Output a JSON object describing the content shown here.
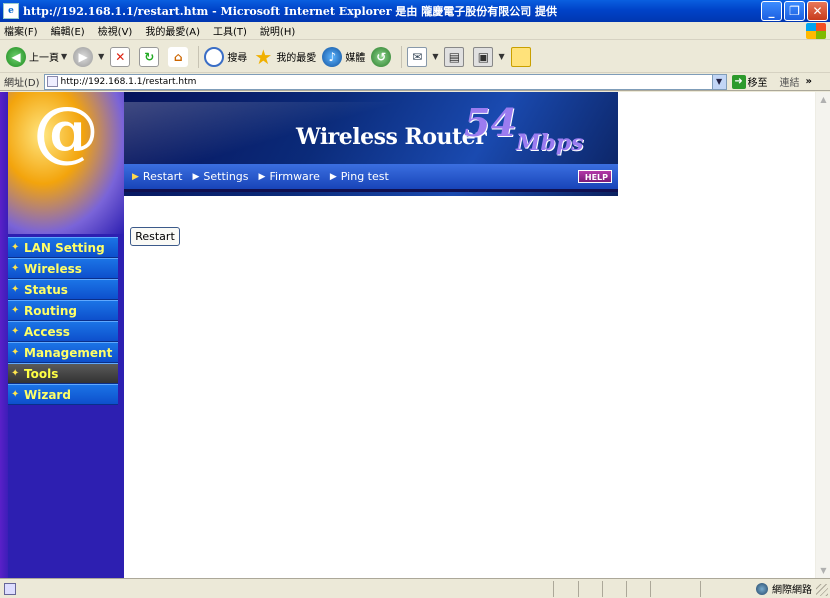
{
  "window": {
    "title": "http://192.168.1.1/restart.htm - Microsoft Internet Explorer 是由 隴慶電子股份有限公司 提供",
    "minimize_glyph": "_",
    "maximize_glyph": "❐",
    "close_glyph": "✕"
  },
  "menu": {
    "items": [
      "檔案(F)",
      "編輯(E)",
      "檢視(V)",
      "我的最愛(A)",
      "工具(T)",
      "說明(H)"
    ]
  },
  "toolbar": {
    "back_label": "上一頁",
    "search_label": "搜尋",
    "favorites_label": "我的最愛",
    "media_label": "媒體"
  },
  "address": {
    "label": "網址(D)",
    "url": "http://192.168.1.1/restart.htm",
    "go_label": "移至",
    "links_label": "連結"
  },
  "banner": {
    "brand": "Wireless Router",
    "speed": "54",
    "speed_unit": "Mbps",
    "help": "HELP"
  },
  "subnav": {
    "items": [
      "Restart",
      "Settings",
      "Firmware",
      "Ping test"
    ]
  },
  "sidebar": {
    "logo": "@",
    "items": [
      "LAN Setting",
      "Wireless",
      "Status",
      "Routing",
      "Access",
      "Management",
      "Tools",
      "Wizard"
    ],
    "active": "Tools"
  },
  "main": {
    "restart_button": "Restart"
  },
  "status": {
    "zone": "網際網路"
  },
  "colors": {
    "sidebar_bg": "#2d1fb1",
    "nav_text": "#ffff66",
    "speed_text": "#9b7cf0"
  }
}
